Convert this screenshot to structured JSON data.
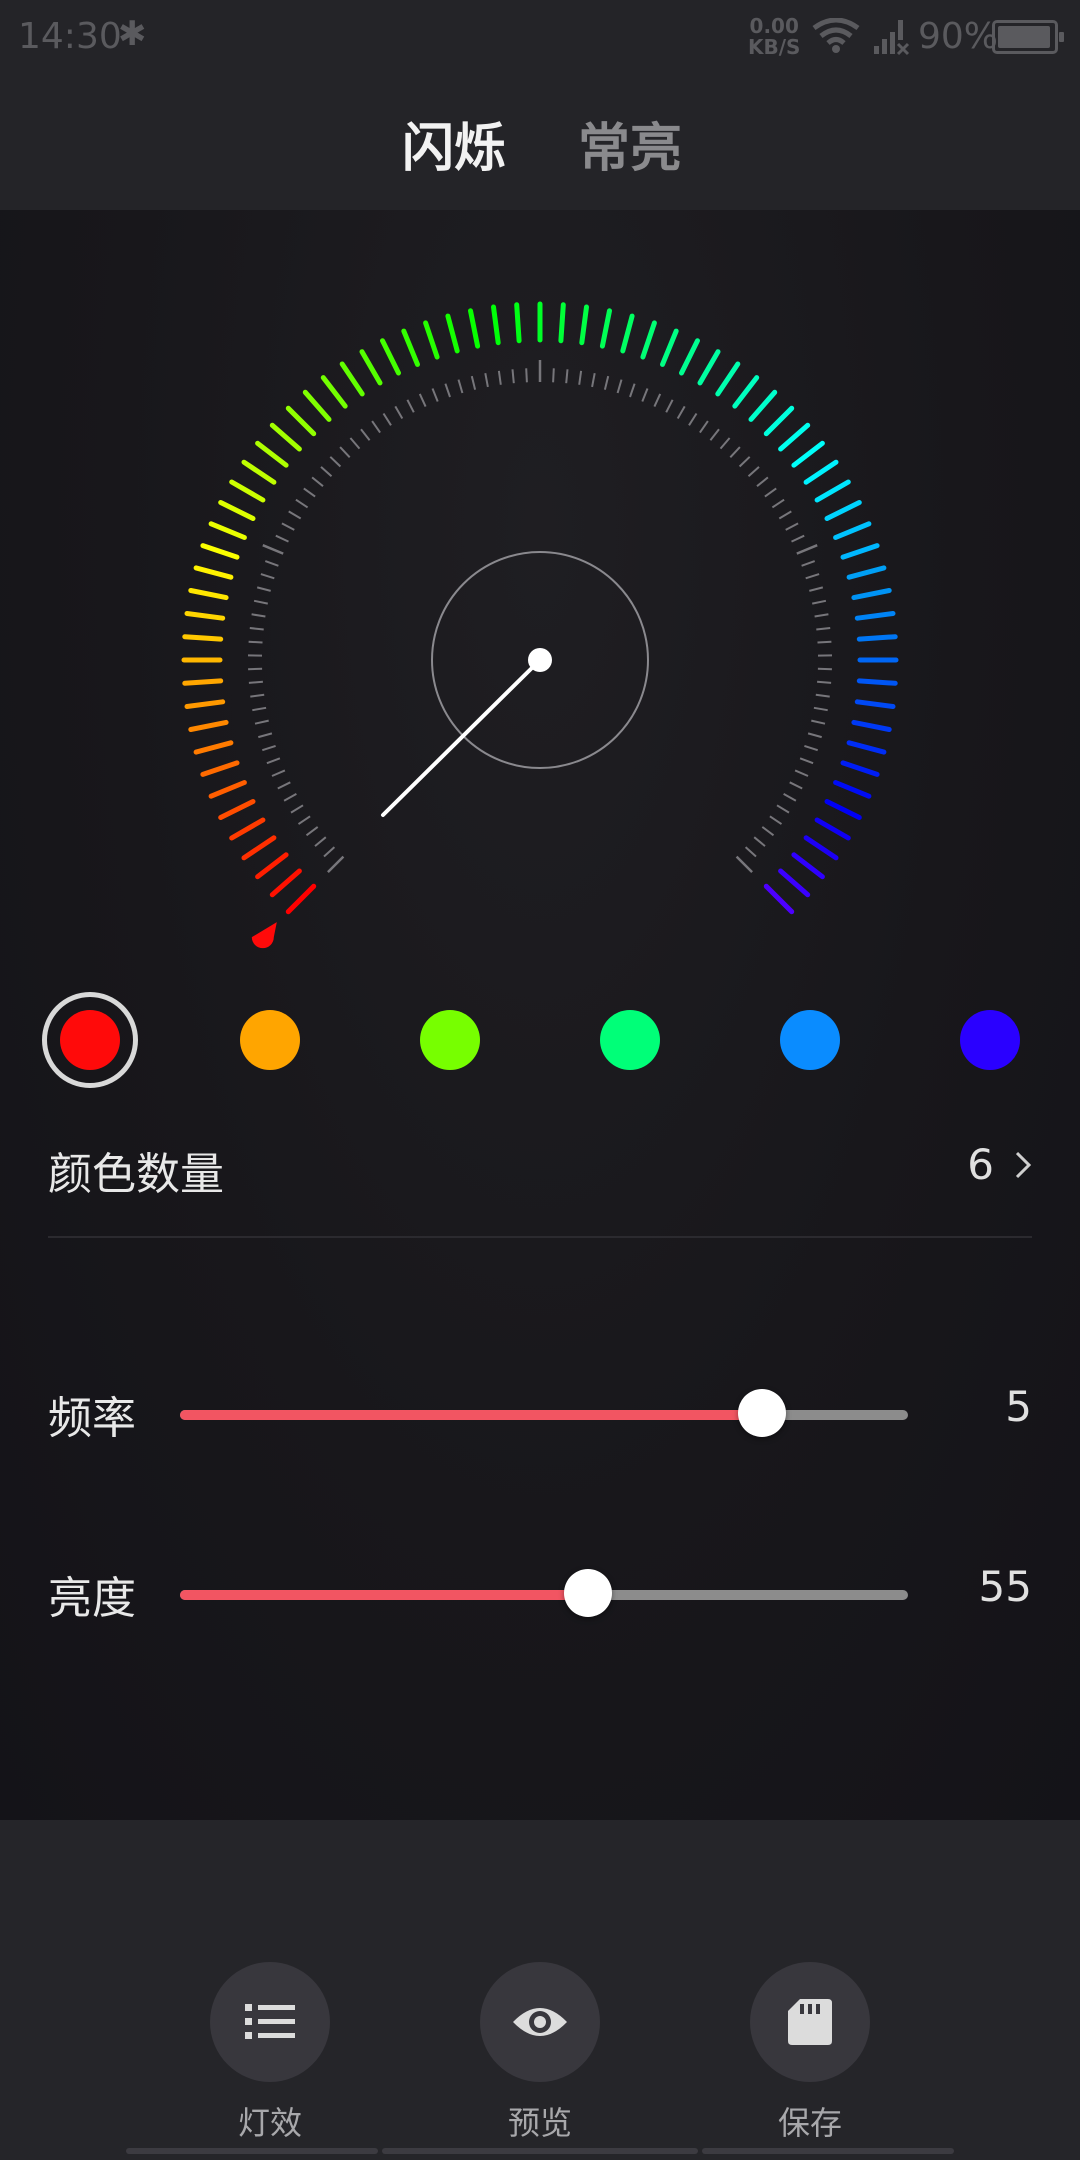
{
  "status_bar": {
    "time": "14:30",
    "net_speed_value": "0.00",
    "net_speed_unit": "KB/S",
    "battery": "90%"
  },
  "tabs": [
    {
      "label": "闪烁",
      "active": true
    },
    {
      "label": "常亮",
      "active": false
    }
  ],
  "color_swatches": [
    {
      "color": "#ff0a0a",
      "selected": true
    },
    {
      "color": "#ffa500",
      "selected": false
    },
    {
      "color": "#77ff00",
      "selected": false
    },
    {
      "color": "#00ff78",
      "selected": false
    },
    {
      "color": "#0a8cff",
      "selected": false
    },
    {
      "color": "#2a00ff",
      "selected": false
    }
  ],
  "color_count": {
    "label": "颜色数量",
    "value": "6"
  },
  "sliders": {
    "frequency": {
      "label": "频率",
      "value": "5",
      "fraction": 0.8
    },
    "brightness": {
      "label": "亮度",
      "value": "55",
      "fraction": 0.56
    }
  },
  "toolbar": {
    "effects_label": "灯效",
    "preview_label": "预览",
    "save_label": "保存"
  },
  "colors": {
    "accent": "#f25562",
    "header_bg": "#242428",
    "main_bg": "#18171b"
  },
  "gauge": {
    "selected_hue_deg": 0
  }
}
